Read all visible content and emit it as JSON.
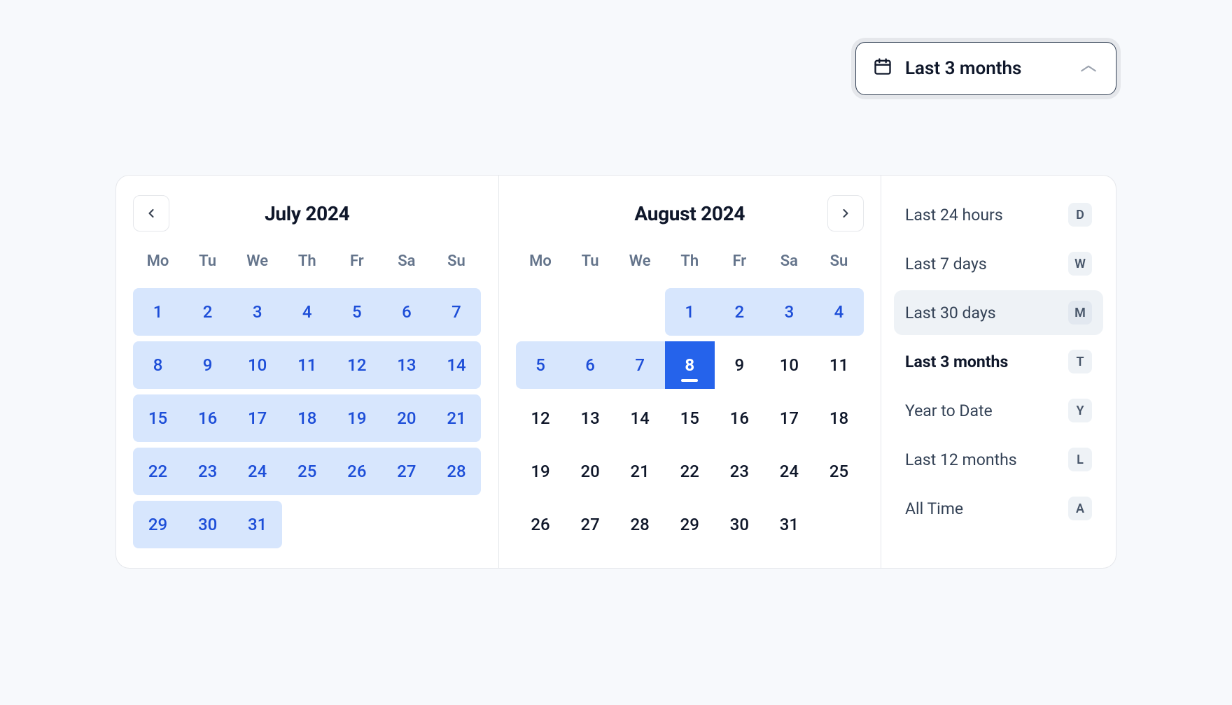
{
  "trigger": {
    "label": "Last 3 months",
    "icon": "calendar-icon"
  },
  "months": [
    {
      "title": "July 2024",
      "nav": "prev",
      "weeks": [
        [
          {
            "d": "1",
            "r": true,
            "first": true
          },
          {
            "d": "2",
            "r": true
          },
          {
            "d": "3",
            "r": true
          },
          {
            "d": "4",
            "r": true
          },
          {
            "d": "5",
            "r": true
          },
          {
            "d": "6",
            "r": true
          },
          {
            "d": "7",
            "r": true,
            "last": true
          }
        ],
        [
          {
            "d": "8",
            "r": true,
            "first": true
          },
          {
            "d": "9",
            "r": true
          },
          {
            "d": "10",
            "r": true
          },
          {
            "d": "11",
            "r": true
          },
          {
            "d": "12",
            "r": true
          },
          {
            "d": "13",
            "r": true
          },
          {
            "d": "14",
            "r": true,
            "last": true
          }
        ],
        [
          {
            "d": "15",
            "r": true,
            "first": true
          },
          {
            "d": "16",
            "r": true
          },
          {
            "d": "17",
            "r": true
          },
          {
            "d": "18",
            "r": true
          },
          {
            "d": "19",
            "r": true
          },
          {
            "d": "20",
            "r": true
          },
          {
            "d": "21",
            "r": true,
            "last": true
          }
        ],
        [
          {
            "d": "22",
            "r": true,
            "first": true
          },
          {
            "d": "23",
            "r": true
          },
          {
            "d": "24",
            "r": true
          },
          {
            "d": "25",
            "r": true
          },
          {
            "d": "26",
            "r": true
          },
          {
            "d": "27",
            "r": true
          },
          {
            "d": "28",
            "r": true,
            "last": true
          }
        ],
        [
          {
            "d": "29",
            "r": true,
            "first": true
          },
          {
            "d": "30",
            "r": true
          },
          {
            "d": "31",
            "r": true,
            "last": true
          },
          {
            "d": ""
          },
          {
            "d": ""
          },
          {
            "d": ""
          },
          {
            "d": ""
          }
        ]
      ]
    },
    {
      "title": "August 2024",
      "nav": "next",
      "weeks": [
        [
          {
            "d": ""
          },
          {
            "d": ""
          },
          {
            "d": ""
          },
          {
            "d": "1",
            "r": true,
            "first": true
          },
          {
            "d": "2",
            "r": true
          },
          {
            "d": "3",
            "r": true
          },
          {
            "d": "4",
            "r": true,
            "last": true
          }
        ],
        [
          {
            "d": "5",
            "r": true,
            "first": true
          },
          {
            "d": "6",
            "r": true
          },
          {
            "d": "7",
            "r": true
          },
          {
            "d": "8",
            "today": true
          },
          {
            "d": "9"
          },
          {
            "d": "10"
          },
          {
            "d": "11"
          }
        ],
        [
          {
            "d": "12"
          },
          {
            "d": "13"
          },
          {
            "d": "14"
          },
          {
            "d": "15"
          },
          {
            "d": "16"
          },
          {
            "d": "17"
          },
          {
            "d": "18"
          }
        ],
        [
          {
            "d": "19"
          },
          {
            "d": "20"
          },
          {
            "d": "21"
          },
          {
            "d": "22"
          },
          {
            "d": "23"
          },
          {
            "d": "24"
          },
          {
            "d": "25"
          }
        ],
        [
          {
            "d": "26"
          },
          {
            "d": "27"
          },
          {
            "d": "28"
          },
          {
            "d": "29"
          },
          {
            "d": "30"
          },
          {
            "d": "31"
          },
          {
            "d": ""
          }
        ]
      ]
    }
  ],
  "dow": [
    "Mo",
    "Tu",
    "We",
    "Th",
    "Fr",
    "Sa",
    "Su"
  ],
  "presets": [
    {
      "label": "Last 24 hours",
      "key": "D"
    },
    {
      "label": "Last 7 days",
      "key": "W"
    },
    {
      "label": "Last 30 days",
      "key": "M",
      "hover": true
    },
    {
      "label": "Last 3 months",
      "key": "T",
      "active": true
    },
    {
      "label": "Year to Date",
      "key": "Y"
    },
    {
      "label": "Last 12 months",
      "key": "L"
    },
    {
      "label": "All Time",
      "key": "A"
    }
  ]
}
